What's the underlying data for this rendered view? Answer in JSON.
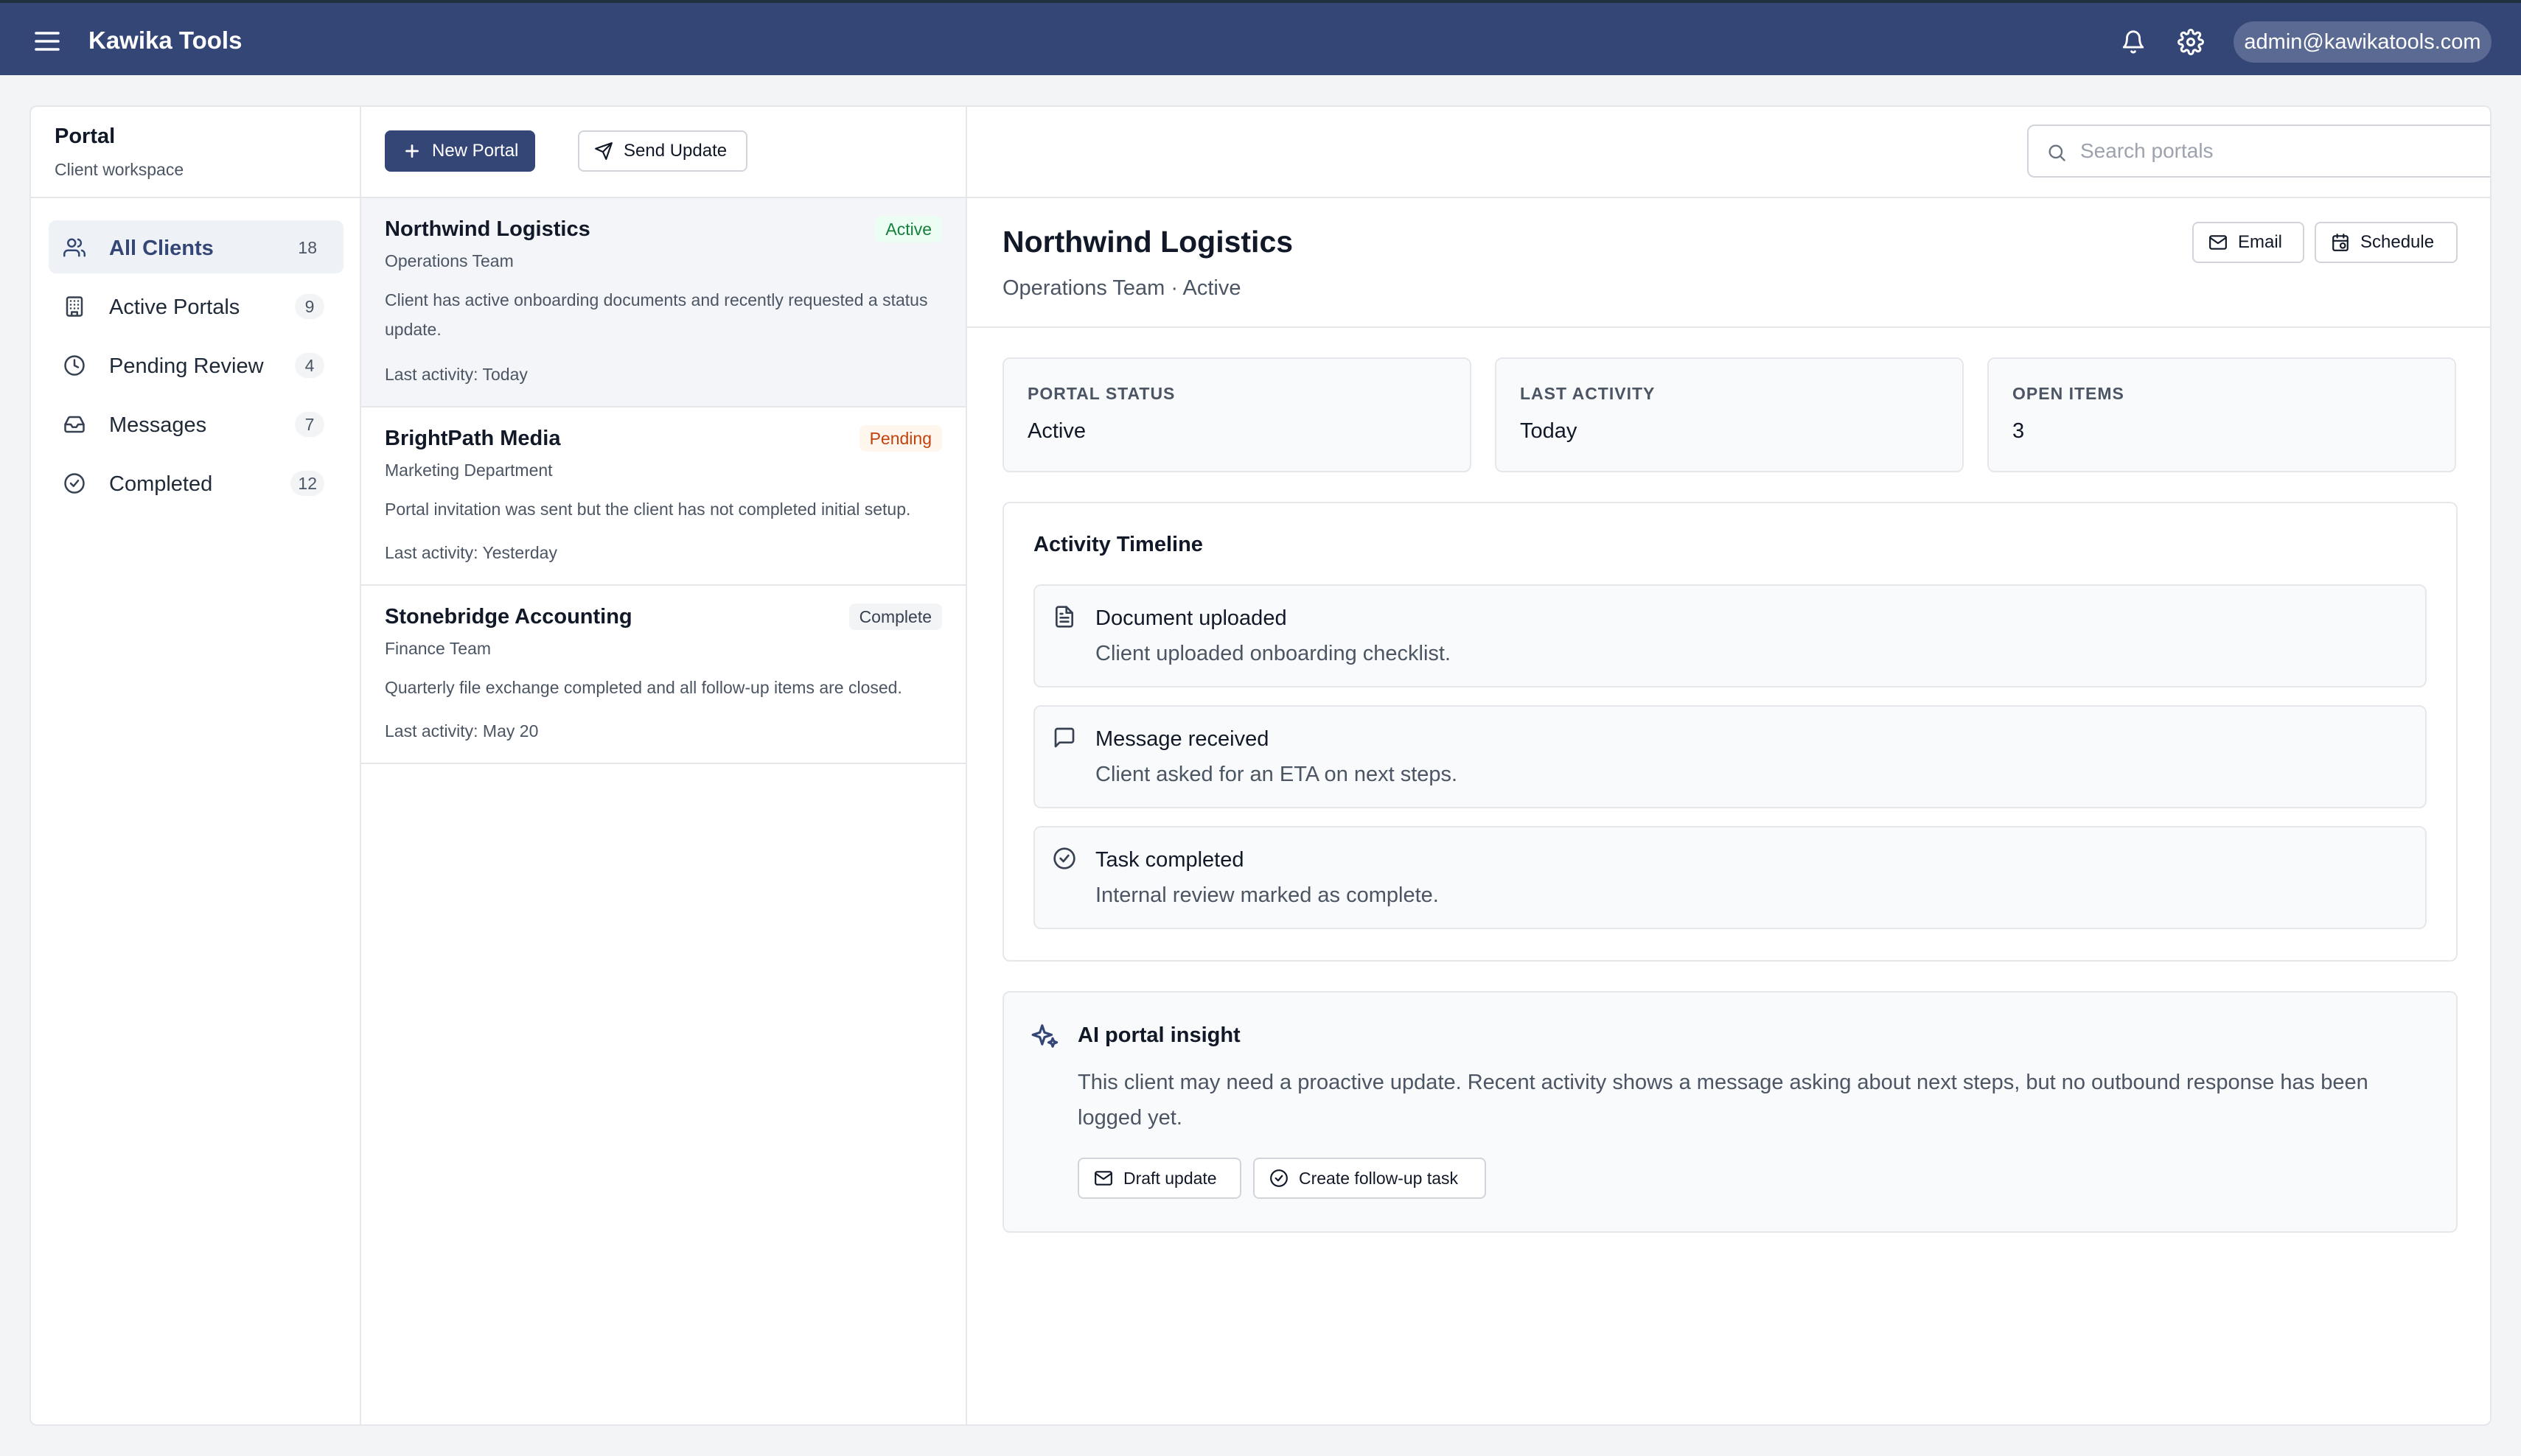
{
  "app": {
    "brand": "Kawika Tools",
    "user_email": "admin@kawikatools.com"
  },
  "sidebar": {
    "title": "Portal",
    "subtitle": "Client workspace",
    "items": [
      {
        "label": "All Clients",
        "count": "18",
        "icon": "users-icon",
        "active": true
      },
      {
        "label": "Active Portals",
        "count": "9",
        "icon": "building-icon"
      },
      {
        "label": "Pending Review",
        "count": "4",
        "icon": "clock-icon"
      },
      {
        "label": "Messages",
        "count": "7",
        "icon": "inbox-icon"
      },
      {
        "label": "Completed",
        "count": "12",
        "icon": "check-circle-icon"
      }
    ]
  },
  "toolbar": {
    "new_portal_label": "New Portal",
    "send_update_label": "Send Update",
    "search_placeholder": "Search portals",
    "search_value": ""
  },
  "clients": [
    {
      "name": "Northwind Logistics",
      "status": "Active",
      "team": "Operations Team",
      "description": "Client has active onboarding documents and recently requested a status update.",
      "last_activity": "Last activity: Today"
    },
    {
      "name": "BrightPath Media",
      "status": "Pending",
      "team": "Marketing Department",
      "description": "Portal invitation was sent but the client has not completed initial setup.",
      "last_activity": "Last activity: Yesterday"
    },
    {
      "name": "Stonebridge Accounting",
      "status": "Complete",
      "team": "Finance Team",
      "description": "Quarterly file exchange completed and all follow-up items are closed.",
      "last_activity": "Last activity: May 20"
    }
  ],
  "detail": {
    "title": "Northwind Logistics",
    "subtitle": "Operations Team · Active",
    "email_label": "Email",
    "schedule_label": "Schedule",
    "stats": [
      {
        "label": "PORTAL STATUS",
        "value": "Active"
      },
      {
        "label": "LAST ACTIVITY",
        "value": "Today"
      },
      {
        "label": "OPEN ITEMS",
        "value": "3"
      }
    ],
    "timeline": {
      "title": "Activity Timeline",
      "items": [
        {
          "title": "Document uploaded",
          "description": "Client uploaded onboarding checklist.",
          "icon": "document-icon"
        },
        {
          "title": "Message received",
          "description": "Client asked for an ETA on next steps.",
          "icon": "message-icon"
        },
        {
          "title": "Task completed",
          "description": "Internal review marked as complete.",
          "icon": "check-circle-icon"
        }
      ]
    },
    "insight": {
      "title": "AI portal insight",
      "text": "This client may need a proactive update. Recent activity shows a message asking about next steps, but no outbound response has been logged yet.",
      "draft_label": "Draft update",
      "followup_label": "Create follow-up task"
    }
  },
  "colors": {
    "header": "#344675",
    "accent": "#344675",
    "active_badge": "#15803d",
    "pending_badge": "#c2410c"
  }
}
